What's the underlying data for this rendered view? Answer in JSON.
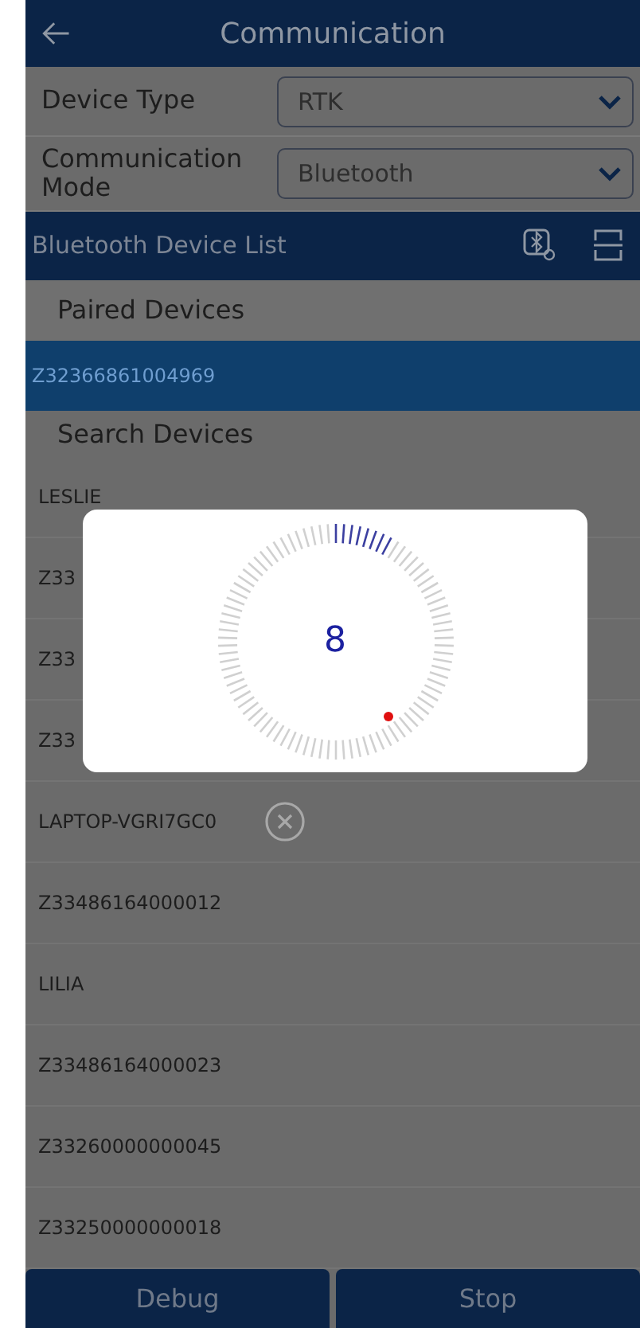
{
  "header": {
    "title": "Communication"
  },
  "fields": [
    {
      "label": "Device Type",
      "value": "RTK"
    },
    {
      "label": "Communication Mode",
      "value": "Bluetooth"
    }
  ],
  "device_list": {
    "title": "Bluetooth Device List"
  },
  "paired": {
    "title": "Paired Devices",
    "items": [
      {
        "name": "Z32366861004969",
        "selected": true
      }
    ]
  },
  "search": {
    "title": "Search Devices",
    "items": [
      {
        "name": "LESLIE",
        "removable": false
      },
      {
        "name": "Z33"
      },
      {
        "name": "Z33"
      },
      {
        "name": "Z33"
      },
      {
        "name": "LAPTOP-VGRI7GC0",
        "removable": true
      },
      {
        "name": "Z33486164000012",
        "removable": false
      },
      {
        "name": "LILIA",
        "removable": false
      },
      {
        "name": "Z33486164000023",
        "removable": false
      },
      {
        "name": "Z33260000000045",
        "removable": false
      },
      {
        "name": "Z33250000000018",
        "removable": false
      }
    ]
  },
  "buttons": [
    "Debug",
    "Stop"
  ],
  "dialog": {
    "count": "8"
  }
}
